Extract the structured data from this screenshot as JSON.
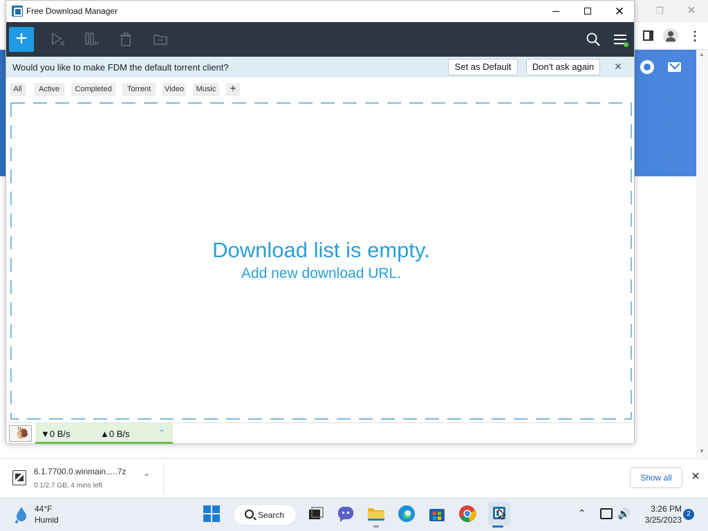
{
  "browser": {
    "restore_glyph": "❐",
    "close_glyph": "✕",
    "menu_glyph": "⋮"
  },
  "fdm": {
    "window_title": "Free Download Manager",
    "controls": {
      "close_glyph": "✕"
    },
    "toolbar": {
      "add_label": "+",
      "accent_color": "#1e9be4",
      "background_color": "#2e3644",
      "icons": [
        "play-icon",
        "pause-icon",
        "trash-icon",
        "folder-icon",
        "search-icon",
        "hamburger-menu-icon"
      ]
    },
    "infobar": {
      "message": "Would you like to make FDM the default torrent client?",
      "set_default_label": "Set as Default",
      "dont_ask_label": "Don't ask again",
      "close_glyph": "✕"
    },
    "tabs": [
      {
        "label": "All"
      },
      {
        "label": "Active"
      },
      {
        "label": "Completed"
      },
      {
        "label": "Torrent"
      },
      {
        "label": "Video"
      },
      {
        "label": "Music"
      }
    ],
    "add_tab_label": "+",
    "empty_state": {
      "title": "Download list is empty.",
      "subtitle": "Add new download URL.",
      "color": "#2a9fd8"
    },
    "statusbar": {
      "snail_glyph": "🐌",
      "download_speed": "▼0 B/s",
      "upload_speed": "▲0 B/s",
      "expand_glyph": "⌃"
    }
  },
  "download_shelf": {
    "filename": "6.1.7700.0.winmain.....7z",
    "status": "0.1/2.7 GB, 4 mins left",
    "chevron_glyph": "⌃",
    "show_all_label": "Show all",
    "close_glyph": "✕"
  },
  "taskbar": {
    "weather": {
      "temperature": "44°F",
      "condition": "Humid"
    },
    "search_label": "Search",
    "apps": [
      "start-button",
      "task-view",
      "teams",
      "file-explorer",
      "edge",
      "store",
      "chrome",
      "free-download-manager"
    ],
    "tray": {
      "chevron_glyph": "⌃",
      "volume_glyph": "🔊",
      "time": "3:26 PM",
      "date": "3/25/2023",
      "notification_count": "2"
    }
  }
}
